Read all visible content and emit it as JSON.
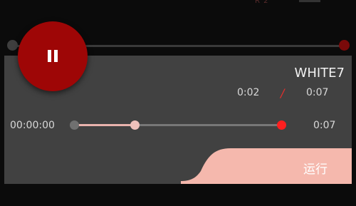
{
  "top_hint": "R 2",
  "track_title": "WHITE7",
  "time": {
    "current": "0:02",
    "separator": "/",
    "total": "0:07"
  },
  "seek": {
    "position_label": "00:00:00",
    "end_label": "0:07",
    "progress_fraction": 0.29
  },
  "run_button": {
    "label": "运行"
  },
  "colors": {
    "accent": "#9e0606",
    "separator": "#e0302d",
    "panel": "#414141",
    "run_button": "#f5b8ad",
    "seek_end": "#ff1f1f"
  },
  "icons": {
    "pause": "pause-icon"
  }
}
